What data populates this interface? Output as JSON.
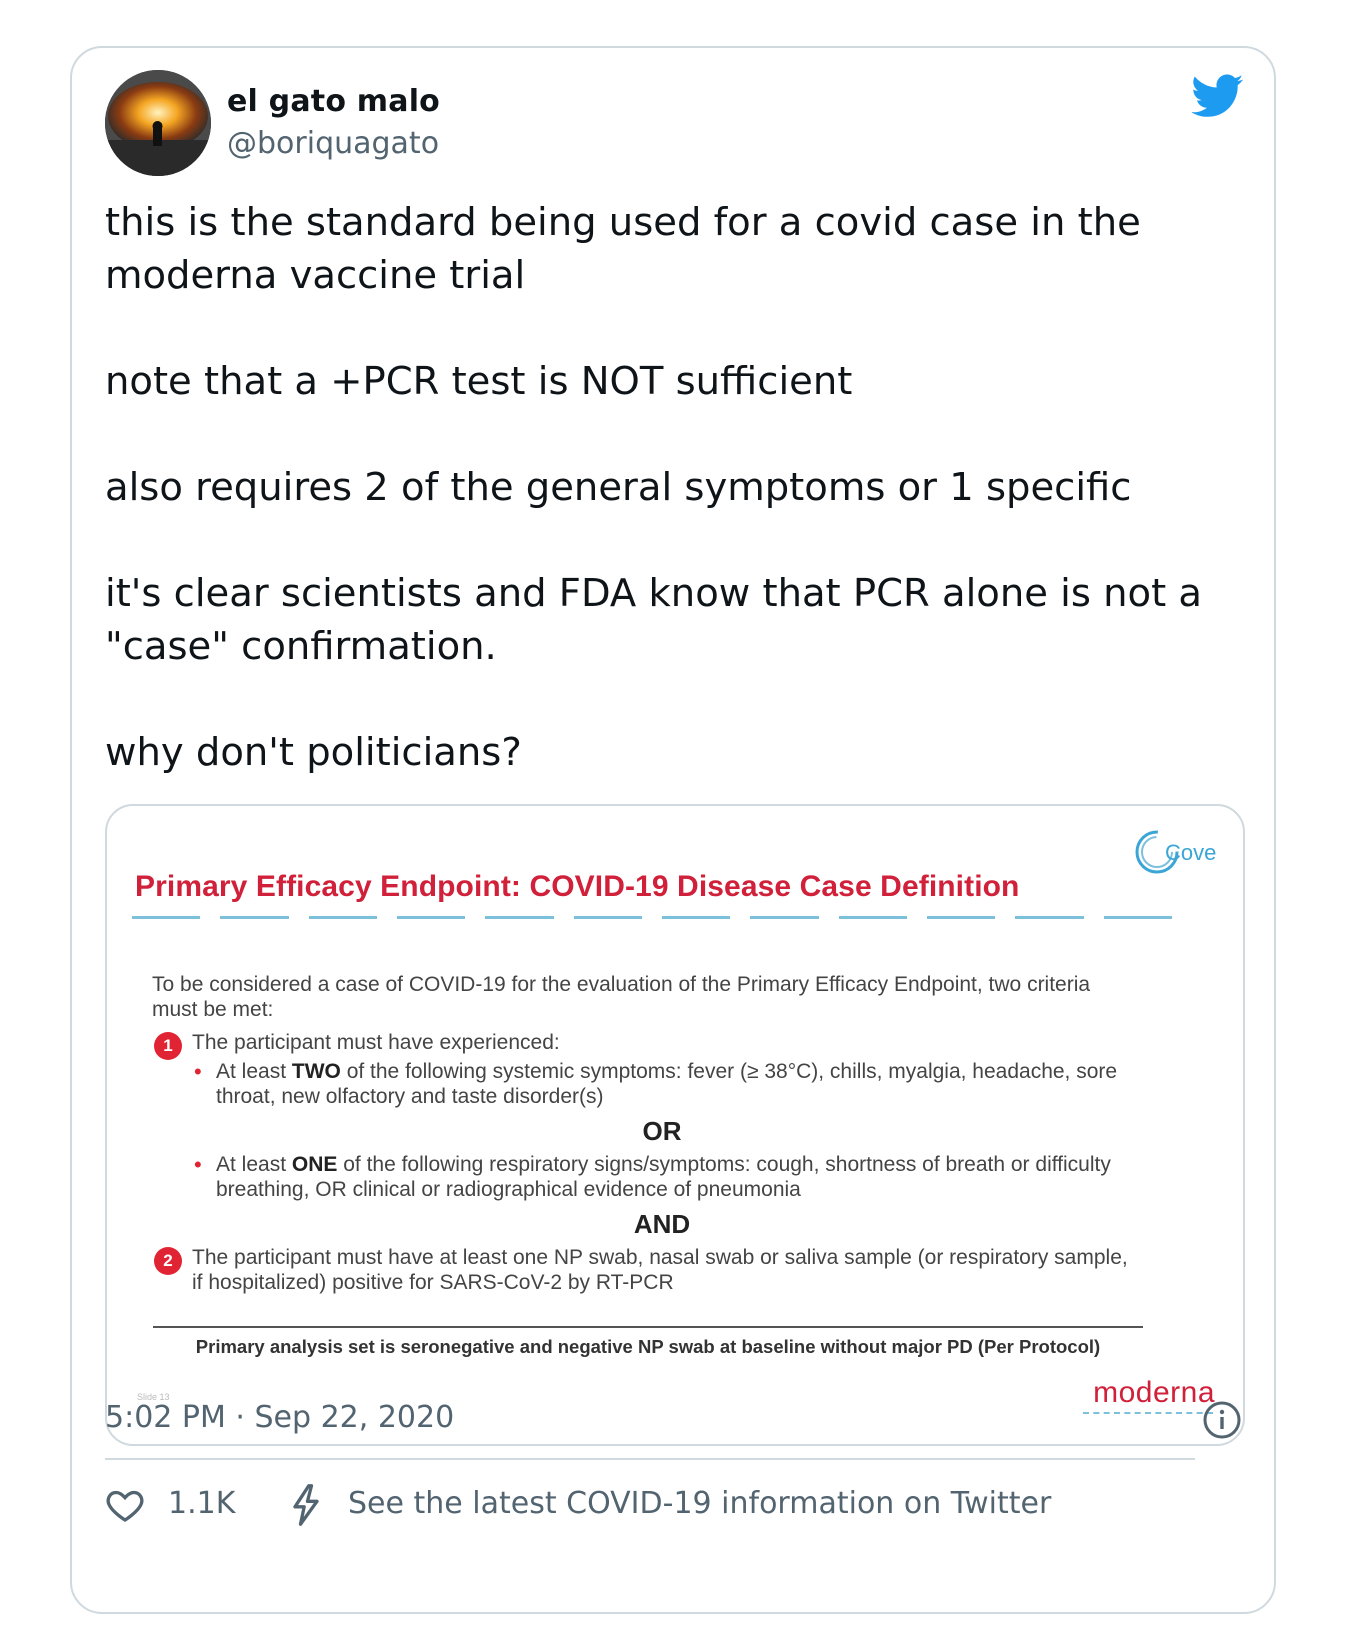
{
  "author": {
    "name": "el gato malo",
    "handle": "@boriquagato"
  },
  "tweet": {
    "paragraphs": [
      "this is the standard being used for a covid case in the moderna vaccine trial",
      "note that a +PCR test is NOT sufficient",
      "also requires 2 of the general symptoms or 1 specific",
      "it's clear scientists and FDA know that PCR alone is not a \"case\" confirmation.",
      "why don't politicians?"
    ]
  },
  "slide": {
    "title": "Primary Efficacy Endpoint: COVID-19 Disease Case Definition",
    "logo_text": "Cove",
    "intro": "To be considered a case of COVID-19 for the evaluation of the Primary Efficacy Endpoint, two criteria must be met:",
    "criterion1_num": "1",
    "criterion1": "The participant must have experienced:",
    "bullet1_pre": "At least ",
    "bullet1_bold": "TWO",
    "bullet1_post": " of the following systemic symptoms: fever (≥ 38°C), chills, myalgia, headache, sore throat, new olfactory and taste disorder(s)",
    "or_label": "OR",
    "bullet2_pre": "At least ",
    "bullet2_bold": "ONE",
    "bullet2_post": " of the following respiratory signs/symptoms: cough, shortness of breath or difficulty breathing, OR clinical or radiographical evidence of pneumonia",
    "and_label": "AND",
    "criterion2_num": "2",
    "criterion2": "The participant must have at least one NP swab, nasal swab or saliva sample (or respiratory sample, if hospitalized) positive for SARS-CoV-2 by RT-PCR",
    "footnote": "Primary analysis set is seronegative and negative NP swab at baseline without major PD (Per Protocol)",
    "slide_number": "Slide 13",
    "brand": "moderna"
  },
  "meta": {
    "timestamp": "5:02 PM · Sep 22, 2020",
    "likes": "1.1K",
    "covid_link": "See the latest COVID-19 information on Twitter"
  },
  "colors": {
    "twitter_blue": "#1d9bf0",
    "slide_red": "#d0203a",
    "muted_text": "#536471",
    "border": "#cfd9de"
  }
}
